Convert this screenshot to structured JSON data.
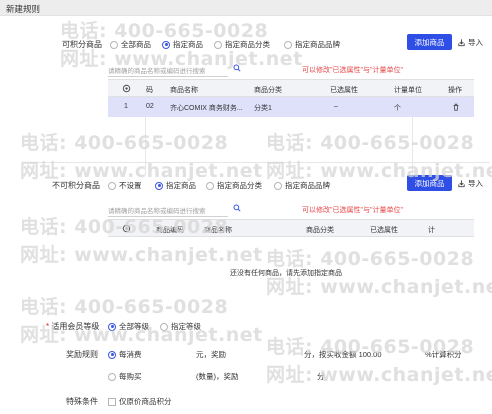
{
  "title": "新建规则",
  "section1": {
    "label": "可积分商品",
    "options": [
      "全部商品",
      "指定商品",
      "指定商品分类",
      "指定商品品牌"
    ],
    "add_button": "添加商品",
    "import_label": "导入",
    "search_placeholder": "请精确的商品名称或编码进行搜索",
    "hint": "可以修改\"已选属性\"与\"计量单位\"",
    "columns": [
      "",
      "码",
      "商品名称",
      "商品分类",
      "已选属性",
      "计量单位",
      "操作"
    ],
    "rows": [
      {
        "index": "1",
        "code": "02",
        "name": "齐心COMIX 商务财务...",
        "category": "分类1",
        "attr": "–",
        "unit": "个"
      }
    ]
  },
  "section2": {
    "label": "不可积分商品",
    "options": [
      "不设置",
      "指定商品",
      "指定商品分类",
      "指定商品品牌"
    ],
    "add_button": "添加商品",
    "import_label": "导入",
    "search_placeholder": "请精确的商品名称或编码进行搜索",
    "hint": "可以修改\"已选属性\"与\"计量单位\"",
    "columns": [
      "",
      "商品编码",
      "商品名称",
      "商品分类",
      "已选属性",
      "计"
    ],
    "empty_text": "还没有任何商品，请先添加指定商品"
  },
  "member": {
    "required_mark": "*",
    "label": "适用会员等级",
    "options": [
      "全部等级",
      "指定等级"
    ]
  },
  "reward": {
    "label": "奖励规则",
    "opt1": "每消费",
    "yuan_reward": "元，奖励",
    "points_text": "分，按实收金额 100.00",
    "percent_text": "%计算积分",
    "opt2": "每购买",
    "qty_reward": "(数量)，奖励",
    "points2": "分"
  },
  "special": {
    "label": "特殊条件",
    "checkbox": "仅原价商品积分"
  },
  "watermark": {
    "phone": "电话: 400-665-0028",
    "site": "网址: www.chanjet.net"
  }
}
